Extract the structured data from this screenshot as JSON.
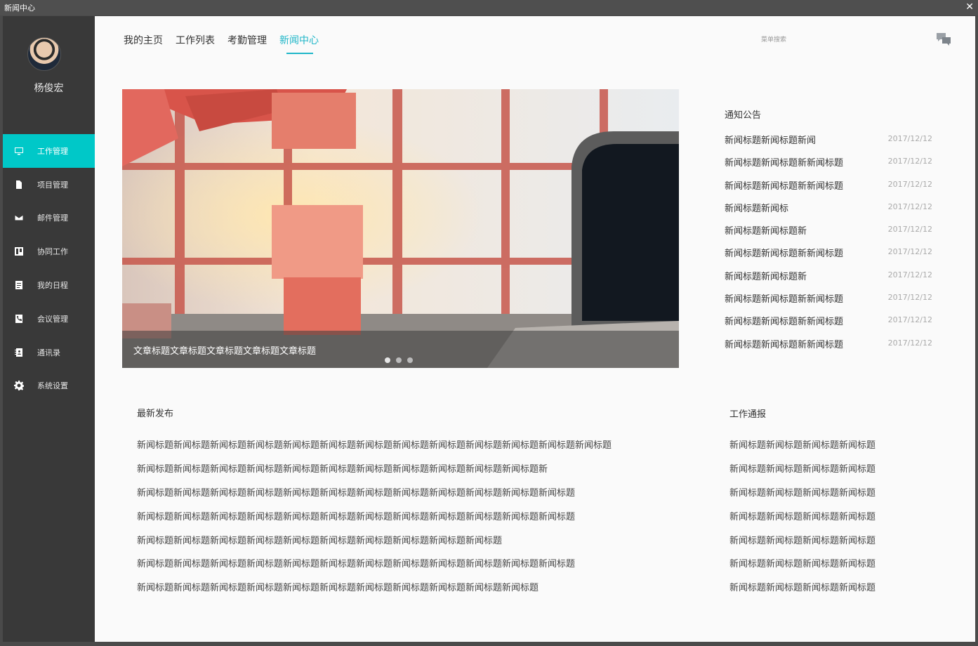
{
  "window": {
    "title": "新闻中心",
    "close_glyph": "✕"
  },
  "user": {
    "name": "杨俊宏"
  },
  "sidebar": {
    "items": [
      {
        "label": "工作管理",
        "icon": "monitor-icon",
        "active": true
      },
      {
        "label": "项目管理",
        "icon": "file-icon"
      },
      {
        "label": "邮件管理",
        "icon": "mail-icon"
      },
      {
        "label": "协同工作",
        "icon": "board-icon"
      },
      {
        "label": "我的日程",
        "icon": "schedule-icon"
      },
      {
        "label": "会议管理",
        "icon": "phone-book-icon"
      },
      {
        "label": "通讯录",
        "icon": "contacts-icon"
      },
      {
        "label": "系统设置",
        "icon": "gear-icon"
      }
    ]
  },
  "nav": {
    "tabs": [
      {
        "label": "我的主页"
      },
      {
        "label": "工作列表"
      },
      {
        "label": "考勤管理"
      },
      {
        "label": "新闻中心",
        "active": true
      }
    ]
  },
  "search": {
    "placeholder": "菜单搜索"
  },
  "banner": {
    "title": "文章标题文章标题文章标题文章标题文章标题",
    "slides": 3,
    "active_slide": 0
  },
  "notices": {
    "title": "通知公告",
    "items": [
      {
        "title": "新闻标题新闻标题新闻",
        "date": "2017/12/12"
      },
      {
        "title": "新闻标题新闻标题新新闻标题",
        "date": "2017/12/12"
      },
      {
        "title": "新闻标题新闻标题新新闻标题",
        "date": "2017/12/12"
      },
      {
        "title": "新闻标题新闻标",
        "date": "2017/12/12"
      },
      {
        "title": "新闻标题新闻标题新",
        "date": "2017/12/12"
      },
      {
        "title": "新闻标题新闻标题新新闻标题",
        "date": "2017/12/12"
      },
      {
        "title": "新闻标题新闻标题新",
        "date": "2017/12/12"
      },
      {
        "title": "新闻标题新闻标题新新闻标题",
        "date": "2017/12/12"
      },
      {
        "title": "新闻标题新闻标题新新闻标题",
        "date": "2017/12/12"
      },
      {
        "title": "新闻标题新闻标题新新闻标题",
        "date": "2017/12/12"
      }
    ]
  },
  "latest": {
    "title": "最新发布",
    "items": [
      "新闻标题新闻标题新闻标题新闻标题新闻标题新闻标题新闻标题新闻标题新闻标题新闻标题新闻标题新闻标题新闻标题",
      "新闻标题新闻标题新闻标题新闻标题新闻标题新闻标题新闻标题新闻标题新闻标题新闻标题新闻标题新",
      "新闻标题新闻标题新闻标题新闻标题新闻标题新闻标题新闻标题新闻标题新闻标题新闻标题新闻标题新闻标题",
      "新闻标题新闻标题新闻标题新闻标题新闻标题新闻标题新闻标题新闻标题新闻标题新闻标题新闻标题新闻标题",
      "新闻标题新闻标题新闻标题新闻标题新闻标题新闻标题新闻标题新闻标题新闻标题新闻标题",
      "新闻标题新闻标题新闻标题新闻标题新闻标题新闻标题新闻标题新闻标题新闻标题新闻标题新闻标题新闻标题",
      "新闻标题新闻标题新闻标题新闻标题新闻标题新闻标题新闻标题新闻标题新闻标题新闻标题新闻标题"
    ]
  },
  "reports": {
    "title": "工作通报",
    "items": [
      "新闻标题新闻标题新闻标题新闻标题",
      "新闻标题新闻标题新闻标题新闻标题",
      "新闻标题新闻标题新闻标题新闻标题",
      "新闻标题新闻标题新闻标题新闻标题",
      "新闻标题新闻标题新闻标题新闻标题",
      "新闻标题新闻标题新闻标题新闻标题",
      "新闻标题新闻标题新闻标题新闻标题"
    ]
  },
  "colors": {
    "accent": "#1fb6c8",
    "sidebar_active": "#00c8c8",
    "sidebar_bg": "#393939"
  }
}
